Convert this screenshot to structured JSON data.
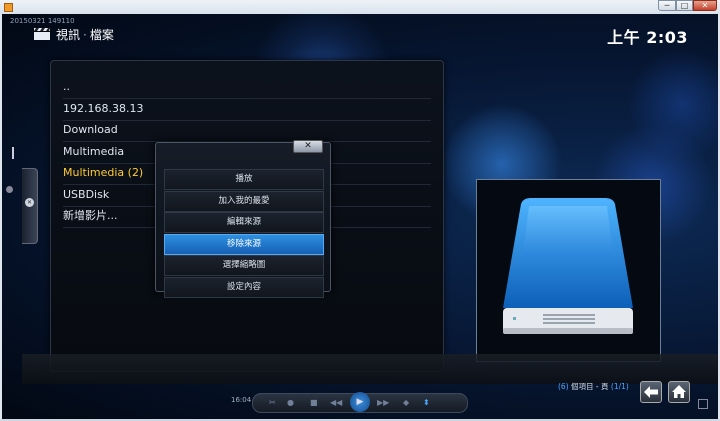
{
  "window": {
    "min_label": "─",
    "max_label": "□",
    "close_label": "✕"
  },
  "timestamp": "20150321 149110",
  "header": {
    "logo_icon": "clapperboard-icon",
    "section": "視訊",
    "subsection": "檔案",
    "time": "上午 2:03"
  },
  "sources": [
    {
      "label": "..",
      "highlighted": false
    },
    {
      "label": "192.168.38.13",
      "highlighted": false
    },
    {
      "label": "Download",
      "highlighted": false
    },
    {
      "label": "Multimedia",
      "highlighted": false
    },
    {
      "label": "Multimedia (2)",
      "highlighted": true
    },
    {
      "label": "USBDisk",
      "highlighted": false
    },
    {
      "label": "新增影片...",
      "highlighted": false
    }
  ],
  "context_menu": {
    "close_label": "✕",
    "items": [
      "播放",
      "加入我的最愛",
      "編輯來源",
      "移除來源",
      "選擇縮略圖",
      "設定內容"
    ],
    "active_index": 3
  },
  "preview": {
    "icon": "hard-drive-icon"
  },
  "status": {
    "count": "(6)",
    "text": "個項目 - 頁",
    "page": "(1/1)"
  },
  "nav": {
    "back_icon": "back-arrow-icon",
    "home_icon": "home-icon"
  },
  "player": {
    "time": "16:04"
  },
  "colors": {
    "accent": "#1f7ad1",
    "highlight_text": "#ffcb2f"
  }
}
